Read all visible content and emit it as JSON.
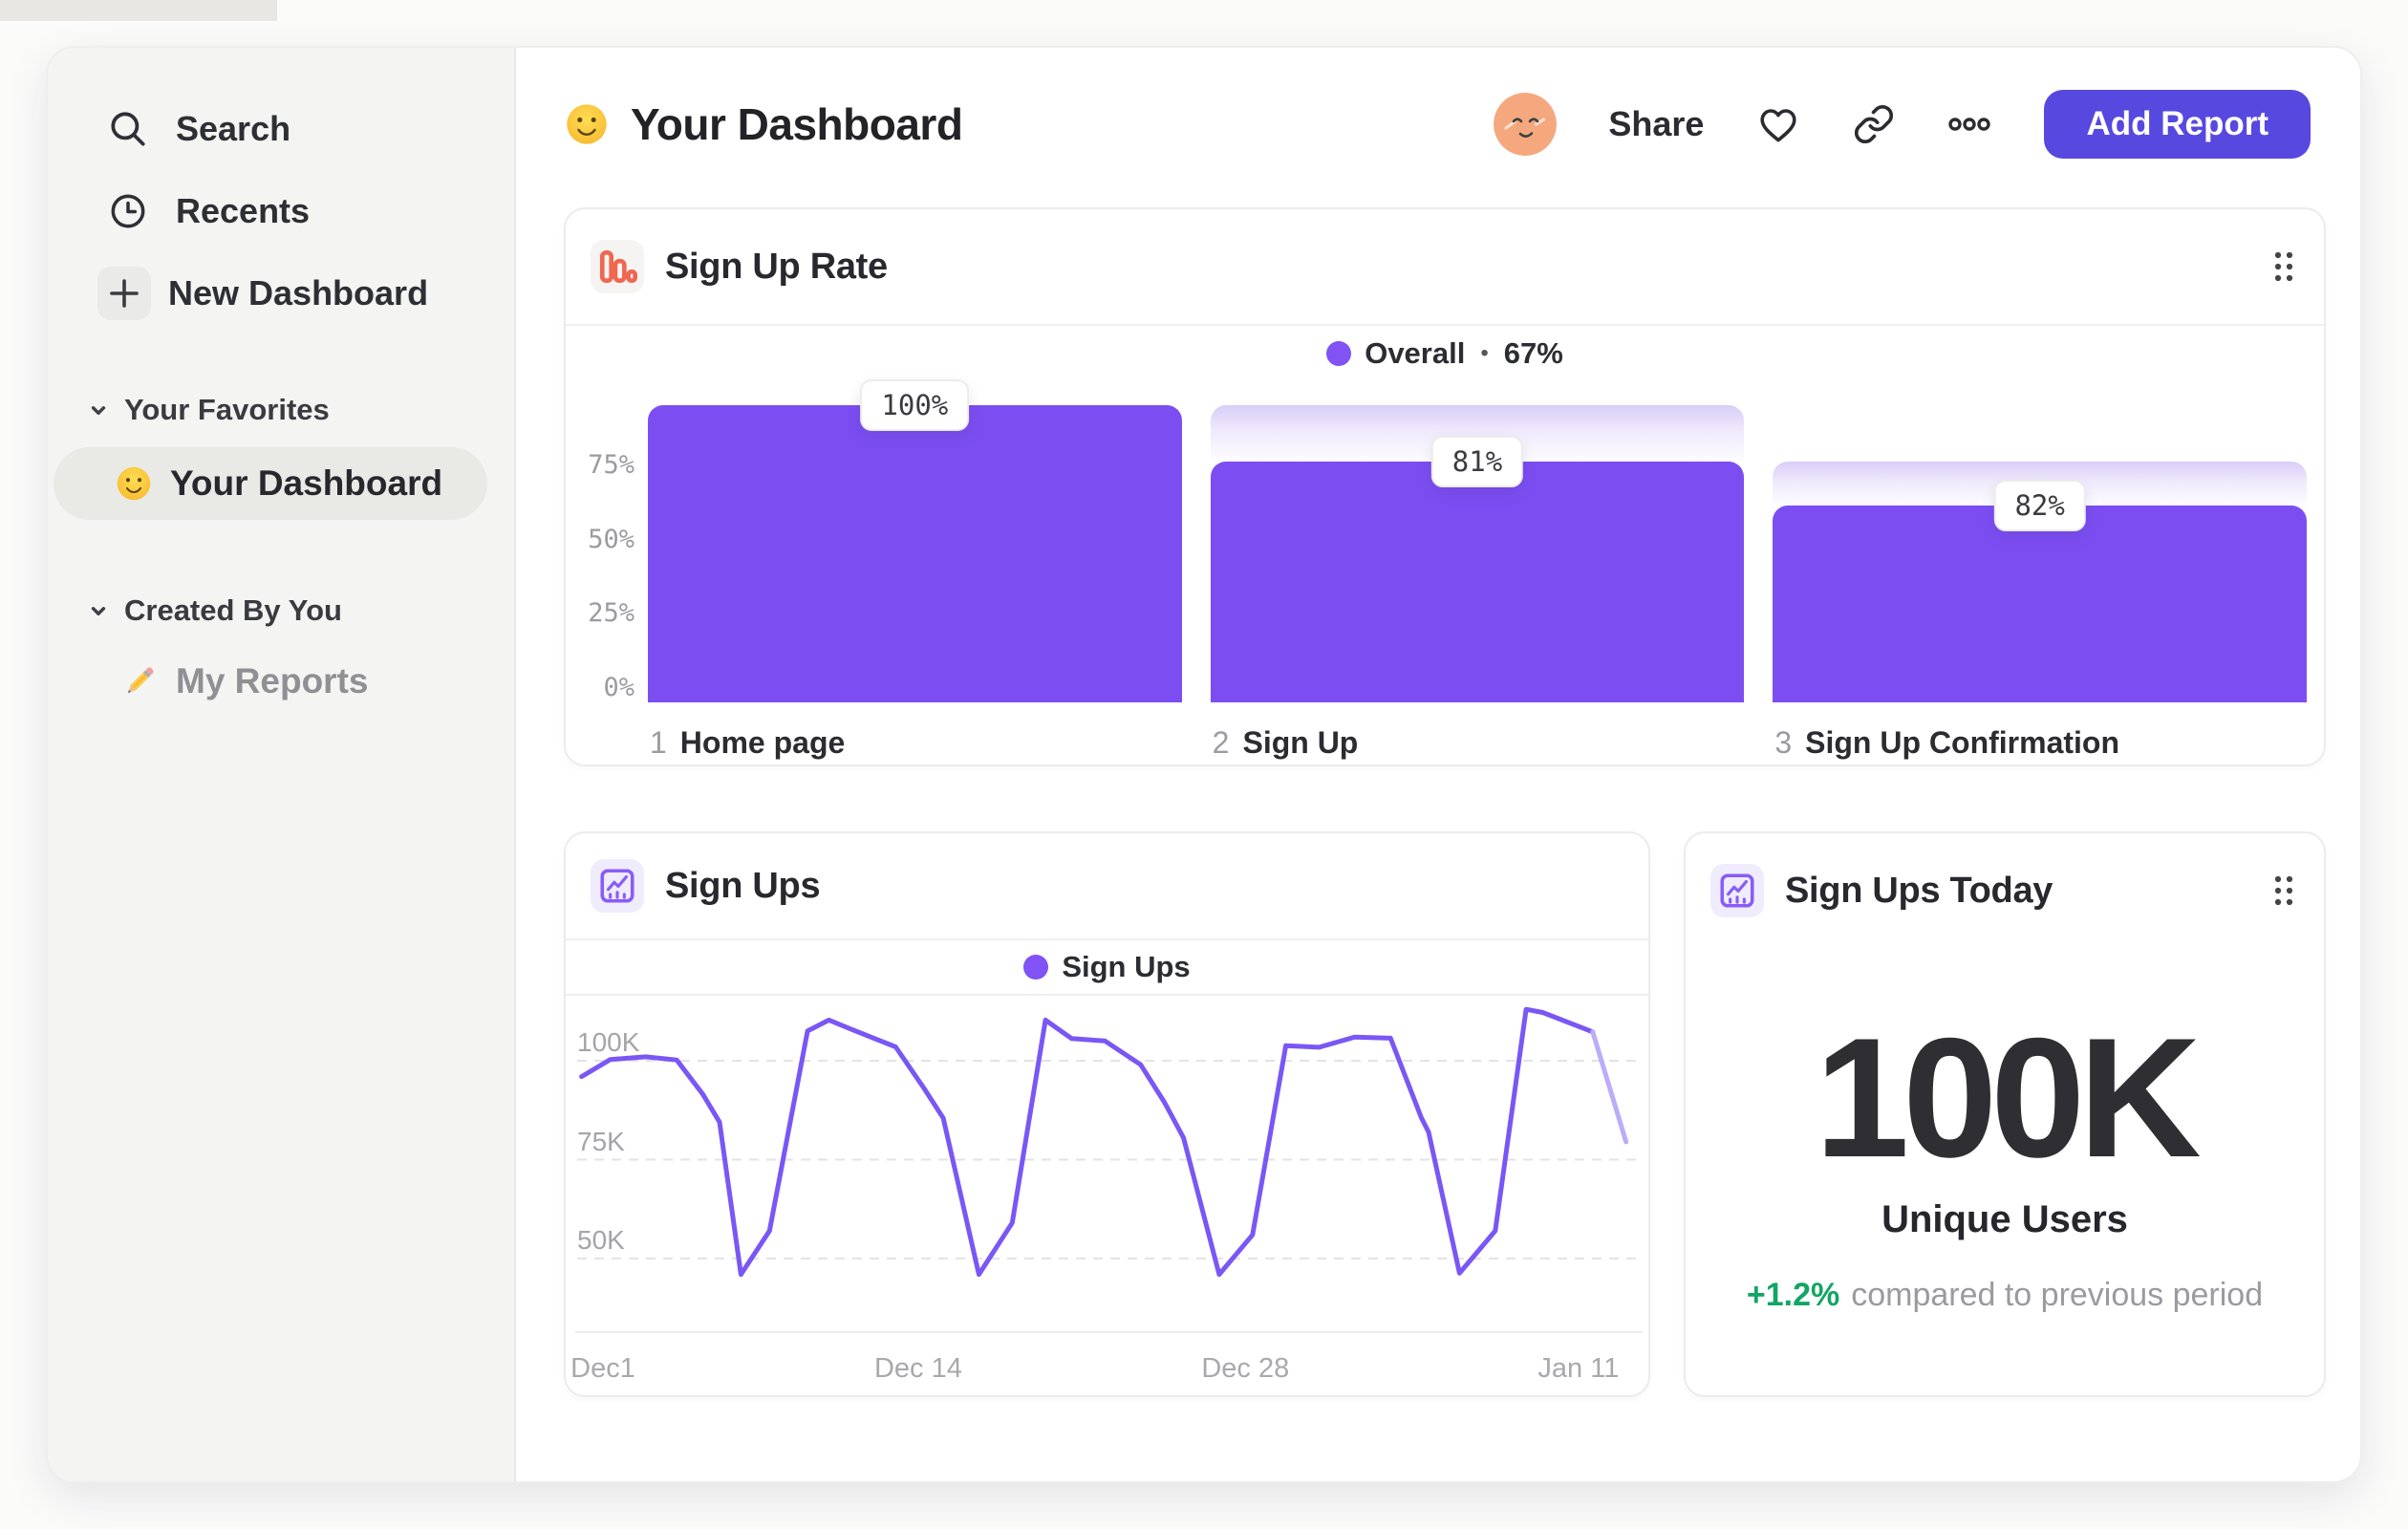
{
  "theme": {
    "accent_purple": "#7C4EF2",
    "line_purple": "#7A57F5",
    "line_purple_light": "#BDACF8",
    "legend_dot": "#8152F4",
    "orange_icon": "#F0664F",
    "green_delta": "#12A564",
    "button_bg": "#5748E0",
    "avatar_bg": "#F5A87E",
    "ghost_top": "#D9CDF7"
  },
  "sidebar": {
    "nav": [
      {
        "icon": "search-icon",
        "label": "Search"
      },
      {
        "icon": "clock-icon",
        "label": "Recents"
      },
      {
        "icon": "plus-icon",
        "label": "New Dashboard"
      }
    ],
    "sections": [
      {
        "label": "Your Favorites",
        "items": [
          {
            "emoji": "slightly-smiling-face",
            "label": "Your Dashboard",
            "selected": true
          }
        ]
      },
      {
        "label": "Created By You",
        "items": [
          {
            "emoji": "pencil",
            "label": "My Reports",
            "selected": false
          }
        ]
      }
    ]
  },
  "header": {
    "emoji": "slightly-smiling-face",
    "title": "Your Dashboard",
    "share_label": "Share",
    "add_report_label": "Add Report"
  },
  "chart_data": [
    {
      "type": "funnel",
      "title": "Sign Up Rate",
      "legend": {
        "label": "Overall",
        "separator": "•",
        "value": "67%"
      },
      "step_indices": [
        "1",
        "2",
        "3"
      ],
      "categories": [
        "Home page",
        "Sign Up",
        "Sign Up Confirmation"
      ],
      "step_conversion_labels": [
        "100%",
        "81%",
        "82%"
      ],
      "overall_pct": [
        100,
        81,
        66.4
      ],
      "ghost_pct": [
        0,
        100,
        81
      ],
      "y_ticks": [
        {
          "label": "75%",
          "pct": 75
        },
        {
          "label": "50%",
          "pct": 50
        },
        {
          "label": "25%",
          "pct": 25
        },
        {
          "label": "0%",
          "pct": 0
        }
      ],
      "ylim": [
        0,
        100
      ],
      "grid": "off",
      "legend_position": "top-center"
    },
    {
      "type": "line",
      "title": "Sign Ups",
      "legend": {
        "label": "Sign Ups",
        "position": "top-center"
      },
      "xlabel": "",
      "ylabel": "",
      "unit": "thousand sign ups (K)",
      "y_ticks": [
        {
          "label": "100K",
          "value": 100
        },
        {
          "label": "75K",
          "value": 75
        },
        {
          "label": "50K",
          "value": 50
        }
      ],
      "x_ticks": [
        {
          "label": "Dec1",
          "day": 0
        },
        {
          "label": "Dec 14",
          "day": 13.25
        },
        {
          "label": "Dec 28",
          "day": 27
        },
        {
          "label": "Jan 11",
          "day": 41
        }
      ],
      "ylim": [
        40,
        115
      ],
      "grid": "horizontal-dashed",
      "series": [
        {
          "name": "Sign Ups",
          "points_day_value_K": [
            [
              -0.9,
              96
            ],
            [
              0.3,
              100.3
            ],
            [
              1.8,
              101
            ],
            [
              3.1,
              100.2
            ],
            [
              4.2,
              91.5
            ],
            [
              4.9,
              84.5
            ],
            [
              5.8,
              46
            ],
            [
              7.0,
              57
            ],
            [
              8.6,
              107.5
            ],
            [
              9.5,
              110.3
            ],
            [
              10.5,
              107.8
            ],
            [
              12.3,
              103.5
            ],
            [
              13.5,
              93
            ],
            [
              14.3,
              85.5
            ],
            [
              15.8,
              46
            ],
            [
              17.2,
              59
            ],
            [
              18.6,
              110.3
            ],
            [
              19.7,
              105.6
            ],
            [
              21.1,
              105
            ],
            [
              22.6,
              99
            ],
            [
              23.6,
              89.5
            ],
            [
              24.4,
              80.5
            ],
            [
              25.9,
              46
            ],
            [
              27.3,
              56
            ],
            [
              28.7,
              103.8
            ],
            [
              30.1,
              103.4
            ],
            [
              31.6,
              106
            ],
            [
              33.1,
              105.7
            ],
            [
              34.4,
              85.5
            ],
            [
              34.7,
              82
            ],
            [
              36.0,
              46.3
            ],
            [
              37.5,
              57
            ],
            [
              38.8,
              113
            ],
            [
              39.5,
              112.2
            ],
            [
              41.6,
              107.3
            ],
            [
              43.0,
              79.5
            ]
          ],
          "light_tail_from_index": 34
        }
      ]
    },
    {
      "type": "metric",
      "title": "Sign Ups Today",
      "value": "100K",
      "label": "Unique Users",
      "delta": "+1.2%",
      "note": "compared to previous period"
    }
  ]
}
